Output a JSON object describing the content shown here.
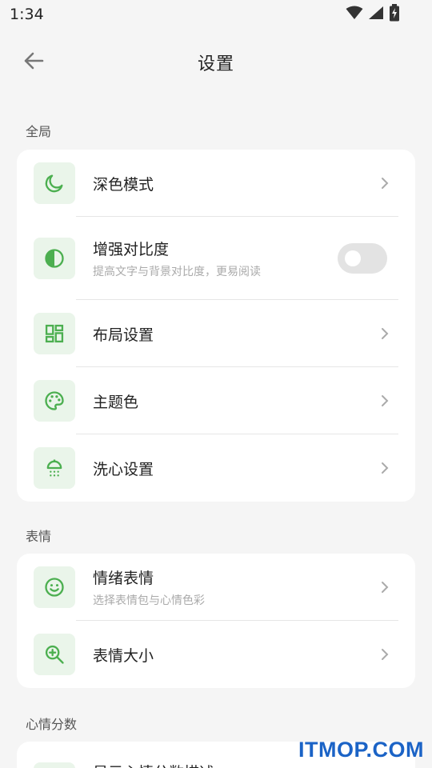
{
  "status_bar": {
    "time": "1:34"
  },
  "header": {
    "title": "设置"
  },
  "sections": {
    "global": {
      "label": "全局",
      "items": [
        {
          "title": "深色模式",
          "icon": "moon-icon"
        },
        {
          "title": "增强对比度",
          "subtitle": "提高文字与背景对比度，更易阅读",
          "icon": "contrast-icon",
          "toggle_on": false
        },
        {
          "title": "布局设置",
          "icon": "layout-grid-icon"
        },
        {
          "title": "主题色",
          "icon": "palette-icon"
        },
        {
          "title": "洗心设置",
          "icon": "shower-icon"
        }
      ]
    },
    "emoji": {
      "label": "表情",
      "items": [
        {
          "title": "情绪表情",
          "subtitle": "选择表情包与心情色彩",
          "icon": "smiley-icon"
        },
        {
          "title": "表情大小",
          "icon": "zoom-in-icon"
        }
      ]
    },
    "score": {
      "label": "心情分数",
      "items": [
        {
          "title": "显示心情分数描述"
        }
      ]
    }
  },
  "watermark": "ITMOP.COM",
  "colors": {
    "accent": "#4caf50",
    "icon_bg": "#eaf5ea",
    "background": "#f5f5f5"
  }
}
